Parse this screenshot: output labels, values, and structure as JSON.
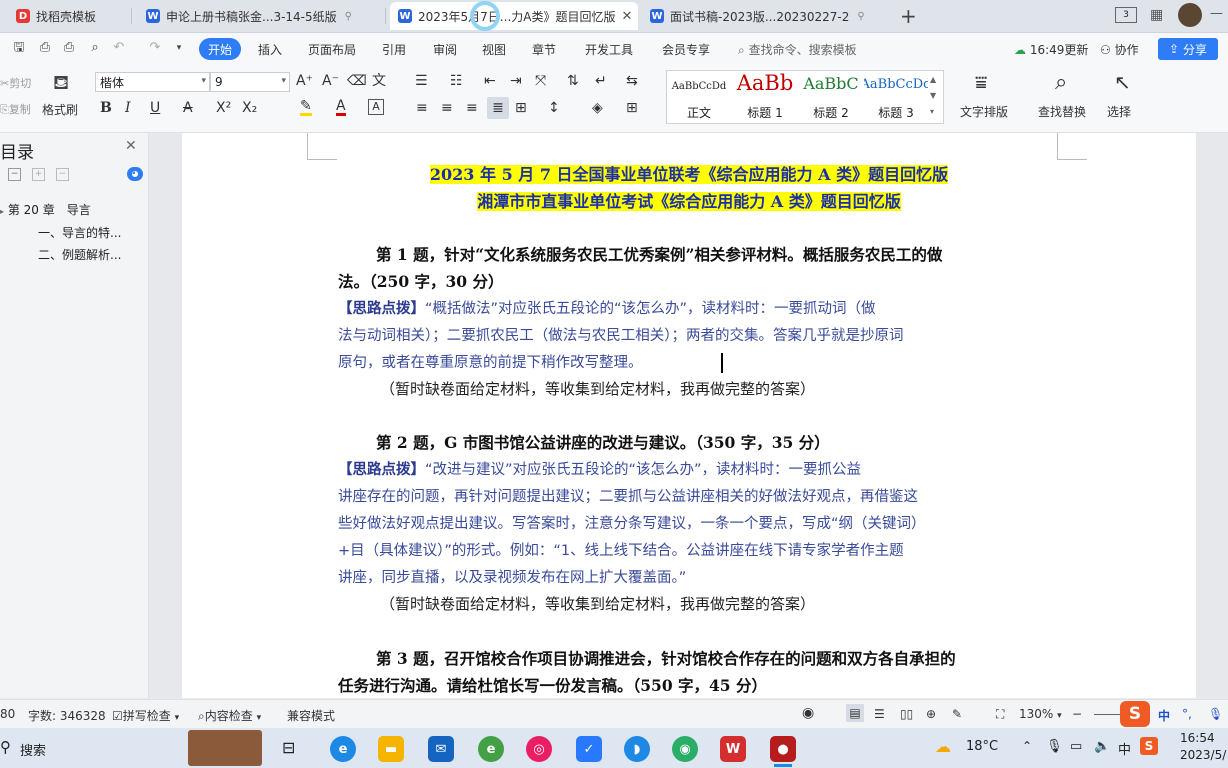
{
  "tabs": [
    {
      "label": "找稻壳模板",
      "color": "#e53935",
      "glyph": "D"
    },
    {
      "label": "申论上册书稿张金...3-14-5纸版",
      "color": "#2b66e0",
      "glyph": "W"
    },
    {
      "label": "2023年5月7日...力A类》题目回忆版",
      "color": "#2b66e0",
      "glyph": "W"
    },
    {
      "label": "面试书稿-2023版...20230227-2",
      "color": "#2b66e0",
      "glyph": "W"
    }
  ],
  "menu": {
    "start": "开始",
    "items": [
      "插入",
      "页面布局",
      "引用",
      "审阅",
      "视图",
      "章节",
      "开发工具",
      "会员专享"
    ],
    "search": "查找命令、搜索模板",
    "update": "16:49更新",
    "collab": "协作",
    "share": "分享"
  },
  "ribbon": {
    "cut": "剪切",
    "copy": "复制",
    "format_painter": "格式刷",
    "font_name": "楷体",
    "font_size": "9",
    "styles": [
      {
        "preview": "AaBbCcDd",
        "label": "正文",
        "color": "#222"
      },
      {
        "preview": "AaBb",
        "label": "标题 1",
        "color": "#c00000"
      },
      {
        "preview": "AaBbC",
        "label": "标题 2",
        "color": "#1e7d32"
      },
      {
        "preview": "AaBbCcDd",
        "label": "标题 3",
        "color": "#1565c0"
      }
    ],
    "text_layout": "文字排版",
    "find_replace": "查找替换",
    "select": "选择"
  },
  "sidebar": {
    "title": "目录",
    "items": [
      {
        "label": "第 20 章　导言",
        "level": 1
      },
      {
        "label": "一、导言的特...",
        "level": 2
      },
      {
        "label": "二、例题解析...",
        "level": 2
      }
    ]
  },
  "document": {
    "heading1": "2023 年 5 月 7 日全国事业单位联考《综合应用能力 A 类》题目回忆版",
    "heading2": "湘潭市市直事业单位考试《综合应用能力 A 类》题目回忆版",
    "lines": [
      {
        "kind": "b",
        "indent": true,
        "text": "第 1 题，针对“文化系统服务农民工优秀案例”相关参评材料。概括服务农民工的做"
      },
      {
        "kind": "b",
        "indent": false,
        "text": "法。（250 字，30 分）"
      },
      {
        "kind": "k",
        "indent": false,
        "prefix": "【思路点拨】",
        "text": "“概括做法”对应张氏五段论的“该怎么办”，读材料时：一要抓动词（做"
      },
      {
        "kind": "k",
        "indent": false,
        "text": "法与动词相关）；二要抓农民工（做法与农民工相关）；两者的交集。答案几乎就是抄原词"
      },
      {
        "kind": "k",
        "indent": false,
        "text": "原句，或者在尊重原意的前提下稍作改写整理。"
      },
      {
        "kind": "n",
        "indent": "half",
        "text": "（暂时缺卷面给定材料，等收集到给定材料，我再做完整的答案）"
      },
      {
        "kind": "b",
        "indent": true,
        "text": "第 2 题，G 市图书馆公益讲座的改进与建议。（350 字，35 分）"
      },
      {
        "kind": "k",
        "indent": false,
        "prefix": "【思路点拨】",
        "text": "“改进与建议”对应张氏五段论的“该怎么办”，读材料时：一要抓公益"
      },
      {
        "kind": "k",
        "indent": false,
        "text": "讲座存在的问题，再针对问题提出建议；二要抓与公益讲座相关的好做法好观点，再借鉴这"
      },
      {
        "kind": "k",
        "indent": false,
        "text": "些好做法好观点提出建议。写答案时，注意分条写建议，一条一个要点，写成“纲（关键词）"
      },
      {
        "kind": "k",
        "indent": false,
        "text": "+目（具体建议）”的形式。例如：“1、线上线下结合。公益讲座在线下请专家学者作主题"
      },
      {
        "kind": "k",
        "indent": false,
        "text": "讲座，同步直播，以及录视频发布在网上扩大覆盖面。”"
      },
      {
        "kind": "n",
        "indent": "half",
        "text": "（暂时缺卷面给定材料，等收集到给定材料，我再做完整的答案）"
      },
      {
        "kind": "b",
        "indent": true,
        "text": "第 3 题，召开馆校合作项目协调推进会，针对馆校合作存在的问题和双方各自承担的"
      },
      {
        "kind": "b",
        "indent": false,
        "text": "任务进行沟通。请给杜馆长写一份发言稿。（550 字，45 分）"
      }
    ]
  },
  "status": {
    "page_num": "80",
    "word_count": "字数: 346328",
    "spell_check": "拼写检查",
    "content_check": "内容检查",
    "compat_mode": "兼容模式",
    "zoom": "130%"
  },
  "taskbar": {
    "search": "搜索",
    "weather": "18°C",
    "ime": "中",
    "time": "16:54",
    "date": "2023/5/"
  }
}
